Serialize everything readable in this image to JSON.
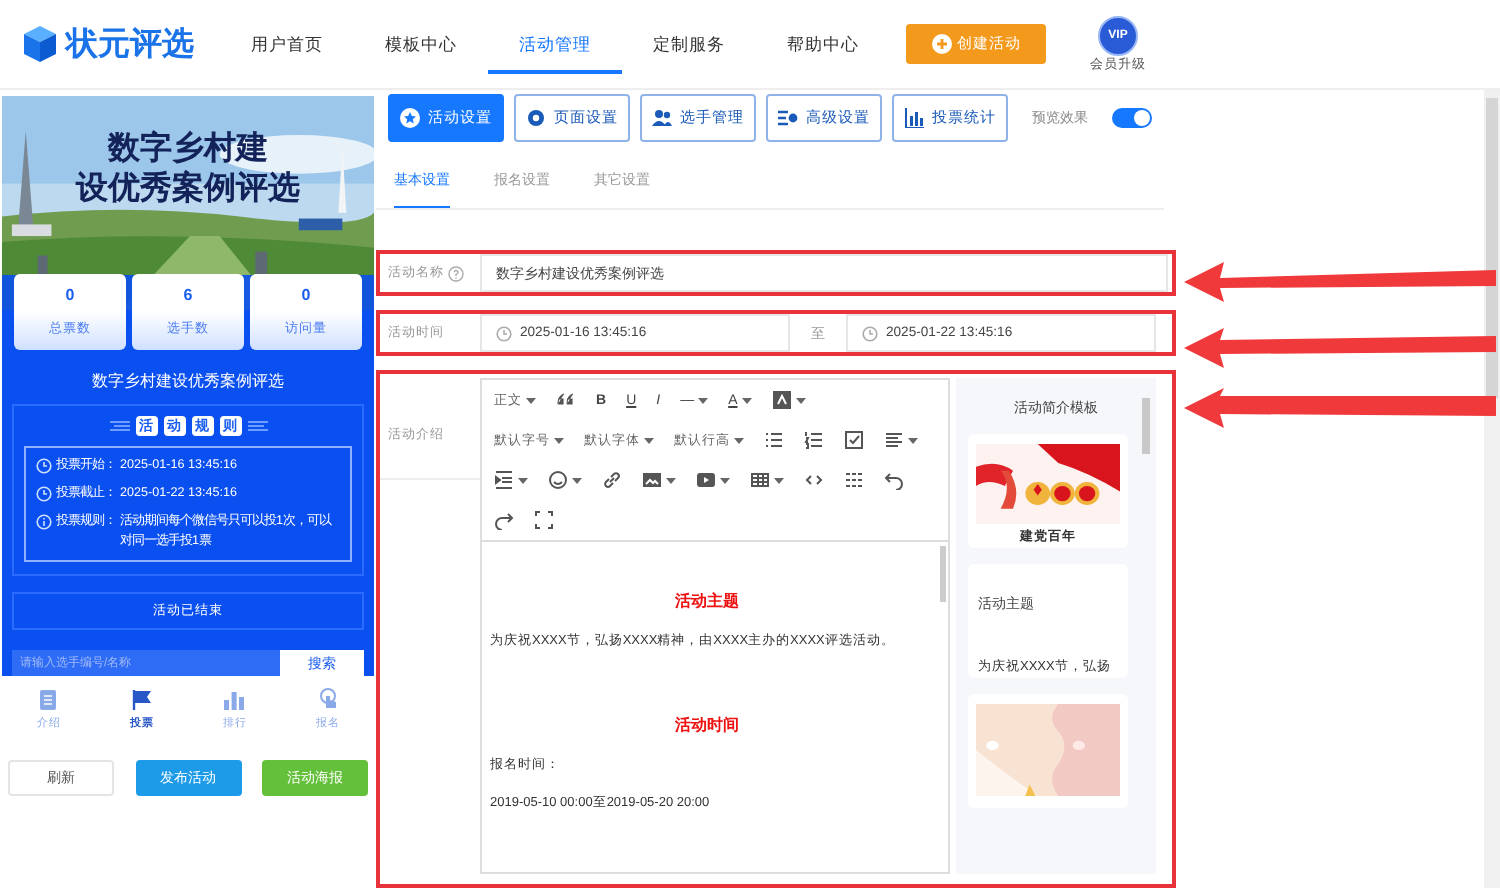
{
  "header": {
    "logo": "状元评选",
    "nav": [
      {
        "label": "用户首页",
        "selected": false
      },
      {
        "label": "模板中心",
        "selected": false
      },
      {
        "label": "活动管理",
        "selected": true
      },
      {
        "label": "定制服务",
        "selected": false
      },
      {
        "label": "帮助中心",
        "selected": false
      }
    ],
    "create_button": "创建活动",
    "vip_badge": "VIP",
    "vip_label": "会员升级"
  },
  "preview": {
    "banner_title": [
      "数字乡村建",
      "设优秀案例评选"
    ],
    "stats": [
      {
        "value": "0",
        "label": "总票数"
      },
      {
        "value": "6",
        "label": "选手数"
      },
      {
        "value": "0",
        "label": "访问量"
      }
    ],
    "title": "数字乡村建设优秀案例评选",
    "rules_heading": [
      "活",
      "动",
      "规",
      "则"
    ],
    "rules": [
      {
        "kind": "time",
        "label": "投票开始：",
        "value": "2025-01-16 13:45:16"
      },
      {
        "kind": "time",
        "label": "投票截止：",
        "value": "2025-01-22 13:45:16"
      },
      {
        "kind": "info",
        "label": "投票规则：",
        "value": "活动期间每个微信号只可以投1次，可以对同一选手投1票"
      }
    ],
    "status": "活动已结束",
    "search_placeholder": "请输入选手编号/名称",
    "search_button": "搜索",
    "nav": [
      {
        "label": "介绍",
        "selected": false
      },
      {
        "label": "投票",
        "selected": true
      },
      {
        "label": "排行",
        "selected": false
      },
      {
        "label": "报名",
        "selected": false
      }
    ]
  },
  "actions": [
    {
      "label": "刷新",
      "kind": "default"
    },
    {
      "label": "发布活动",
      "kind": "primary"
    },
    {
      "label": "活动海报",
      "kind": "success"
    }
  ],
  "settings": {
    "tabs": [
      {
        "label": "活动设置",
        "selected": true
      },
      {
        "label": "页面设置",
        "selected": false
      },
      {
        "label": "选手管理",
        "selected": false
      },
      {
        "label": "高级设置",
        "selected": false
      },
      {
        "label": "投票统计",
        "selected": false
      }
    ],
    "preview_toggle": {
      "label": "预览效果",
      "on": true
    },
    "subtabs": [
      {
        "label": "基本设置",
        "selected": true
      },
      {
        "label": "报名设置",
        "selected": false
      },
      {
        "label": "其它设置",
        "selected": false
      }
    ],
    "name_label": "活动名称",
    "name_value": "数字乡村建设优秀案例评选",
    "time_label": "活动时间",
    "time_start": "2025-01-16 13:45:16",
    "time_sep": "至",
    "time_end": "2025-01-22 13:45:16",
    "intro_label": "活动介绍"
  },
  "editor": {
    "selects": [
      "正文",
      "默认字号",
      "默认字体",
      "默认行高"
    ],
    "glyphs": [
      "B",
      "U",
      "I",
      "—",
      "A"
    ],
    "content": [
      {
        "kind": "heading",
        "text": "活动主题"
      },
      {
        "kind": "paragraph",
        "text": "为庆祝XXXX节，弘扬XXXX精神，由XXXX主办的XXXX评选活动。"
      },
      {
        "kind": "heading",
        "text": "活动时间"
      },
      {
        "kind": "paragraph",
        "text": "报名时间："
      },
      {
        "kind": "paragraph",
        "text": "2019-05-10 00:00至2019-05-20 20:00"
      }
    ]
  },
  "templates": {
    "title": "活动简介模板",
    "cards": [
      {
        "kind": "captioned",
        "caption": "建党百年"
      },
      {
        "kind": "text",
        "title": "活动主题",
        "text": "为庆祝XXXX节，弘扬"
      },
      {
        "kind": "plain"
      }
    ]
  }
}
